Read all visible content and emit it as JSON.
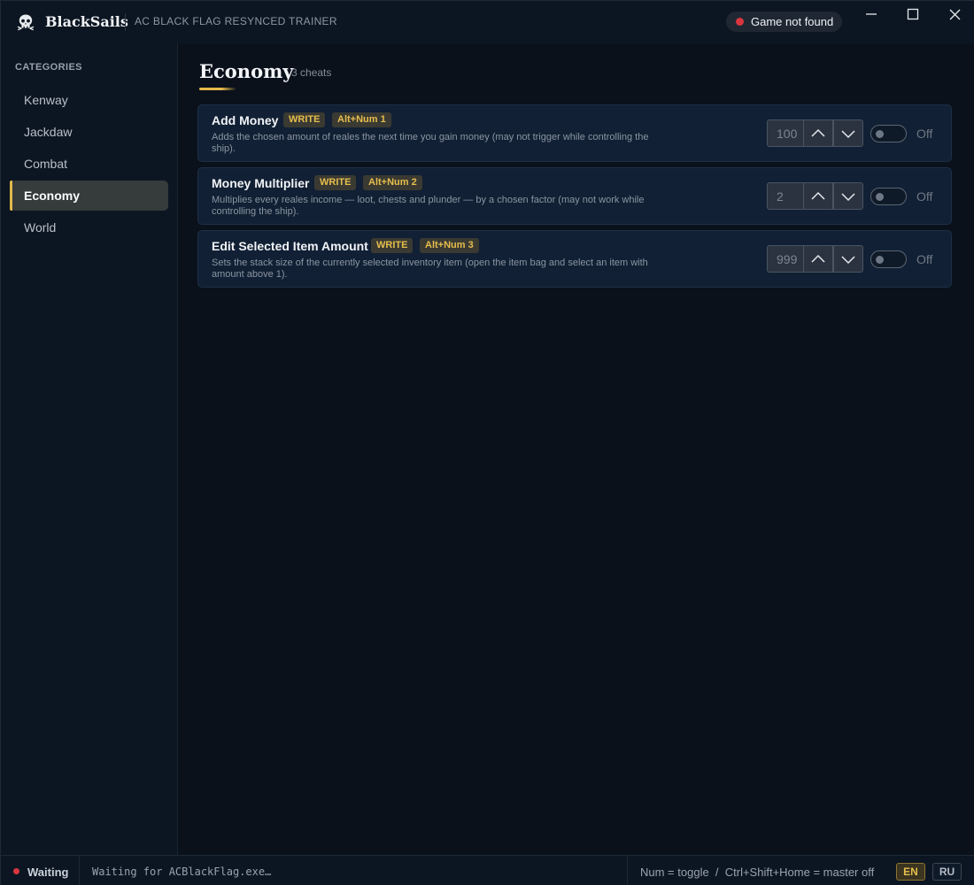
{
  "app": {
    "brand": "BlackSails",
    "subtitle": "AC BLACK FLAG RESYNCED TRAINER",
    "game_status": "Game not found"
  },
  "sidebar": {
    "heading": "CATEGORIES",
    "items": [
      {
        "label": "Kenway",
        "active": false
      },
      {
        "label": "Jackdaw",
        "active": false
      },
      {
        "label": "Combat",
        "active": false
      },
      {
        "label": "Economy",
        "active": true
      },
      {
        "label": "World",
        "active": false
      }
    ]
  },
  "main": {
    "title": "Economy",
    "count": "3 cheats",
    "cheats": [
      {
        "name": "Add Money",
        "mode": "WRITE",
        "hotkey": "Alt+Num 1",
        "description": "Adds the chosen amount of reales the next time you gain money (may not trigger while controlling the ship).",
        "value": "100",
        "toggle": "Off"
      },
      {
        "name": "Money Multiplier",
        "mode": "WRITE",
        "hotkey": "Alt+Num 2",
        "description": "Multiplies every reales income — loot, chests and plunder — by a chosen factor (may not work while controlling the ship).",
        "value": "2",
        "toggle": "Off"
      },
      {
        "name": "Edit Selected Item Amount",
        "mode": "WRITE",
        "hotkey": "Alt+Num 3",
        "description": "Sets the stack size of the currently selected inventory item (open the item bag and select an item with amount above 1).",
        "value": "999",
        "toggle": "Off"
      }
    ]
  },
  "statusbar": {
    "state": "Waiting",
    "message": "Waiting for ACBlackFlag.exe…",
    "hint": "Num = toggle  /  Ctrl+Shift+Home = master off",
    "languages": [
      "EN",
      "RU"
    ],
    "active_language": "EN"
  },
  "colors": {
    "accent": "#e0b94c",
    "error": "#d9363e",
    "background": "#0a111b",
    "panel": "#0c1622",
    "card": "#112034"
  },
  "icons": {
    "brand": "skull-icon",
    "minimize": "minimize-icon",
    "maximize": "maximize-icon",
    "close": "close-icon",
    "increment": "chevron-up-icon",
    "decrement": "chevron-down-icon"
  }
}
